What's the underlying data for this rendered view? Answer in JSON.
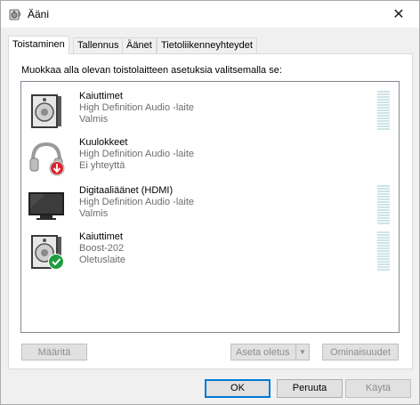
{
  "window": {
    "title": "Ääni",
    "close_glyph": "✕"
  },
  "tabs": [
    {
      "label": "Toistaminen",
      "active": true
    },
    {
      "label": "Tallennus",
      "active": false
    },
    {
      "label": "Äänet",
      "active": false
    },
    {
      "label": "Tietoliikenneyhteydet",
      "active": false
    }
  ],
  "instruction": "Muokkaa alla olevan toistolaitteen asetuksia valitsemalla se:",
  "devices": [
    {
      "name": "Kaiuttimet",
      "description": "High Definition Audio -laite",
      "status": "Valmis",
      "icon": "speaker-icon",
      "overlay": "none"
    },
    {
      "name": "Kuulokkeet",
      "description": "High Definition Audio -laite",
      "status": "Ei yhteyttä",
      "icon": "headphones-icon",
      "overlay": "disconnected-arrow"
    },
    {
      "name": "Digitaaliäänet (HDMI)",
      "description": "High Definition Audio -laite",
      "status": "Valmis",
      "icon": "monitor-icon",
      "overlay": "none"
    },
    {
      "name": "Kaiuttimet",
      "description": "Boost-202",
      "status": "Oletuslaite",
      "icon": "speaker-icon",
      "overlay": "default-check"
    }
  ],
  "buttons": {
    "configure": "Määritä",
    "set_default": "Aseta oletus",
    "properties": "Ominaisuudet",
    "ok": "OK",
    "cancel": "Peruuta",
    "apply": "Käytä"
  },
  "colors": {
    "accent": "#0078d7",
    "check_green": "#1e9e3e",
    "alert_red": "#d9232e"
  }
}
